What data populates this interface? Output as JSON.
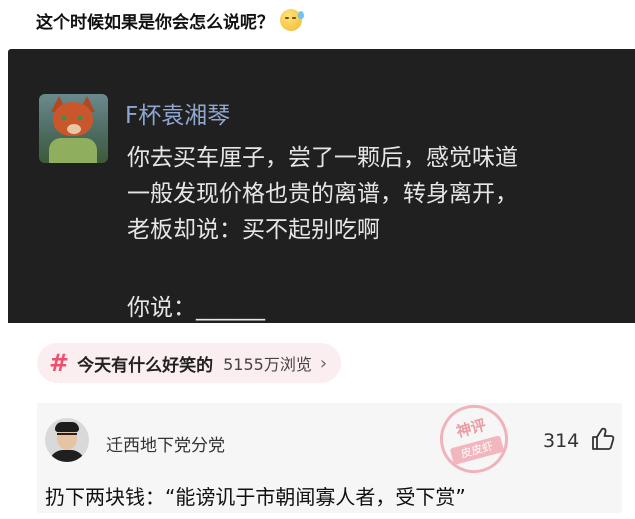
{
  "question": {
    "text": "这个时候如果是你会怎么说呢？",
    "emoji_icon": "smiling-face-with-sweat-icon"
  },
  "post": {
    "author": "F杯袁湘琴",
    "lines": [
      "你去买车厘子，尝了一颗后，感觉味道",
      "一般发现价格也贵的离谱，转身离开，",
      "老板却说：买不起别吃啊"
    ],
    "prompt": "你说：______",
    "avatar_icon": "fox-avatar-icon"
  },
  "topic": {
    "icon": "#",
    "title": "今天有什么好笑的",
    "views": "5155万浏览",
    "chevron": "›",
    "accent_color": "#ef4f6e"
  },
  "comment": {
    "username": "迁西地下党分党",
    "like_count": "314",
    "text": "扔下两块钱：“能谤讥于市朝闻寡人者，受下赏”"
  },
  "watermark": {
    "top": "神评",
    "bottom": "皮皮虾"
  }
}
